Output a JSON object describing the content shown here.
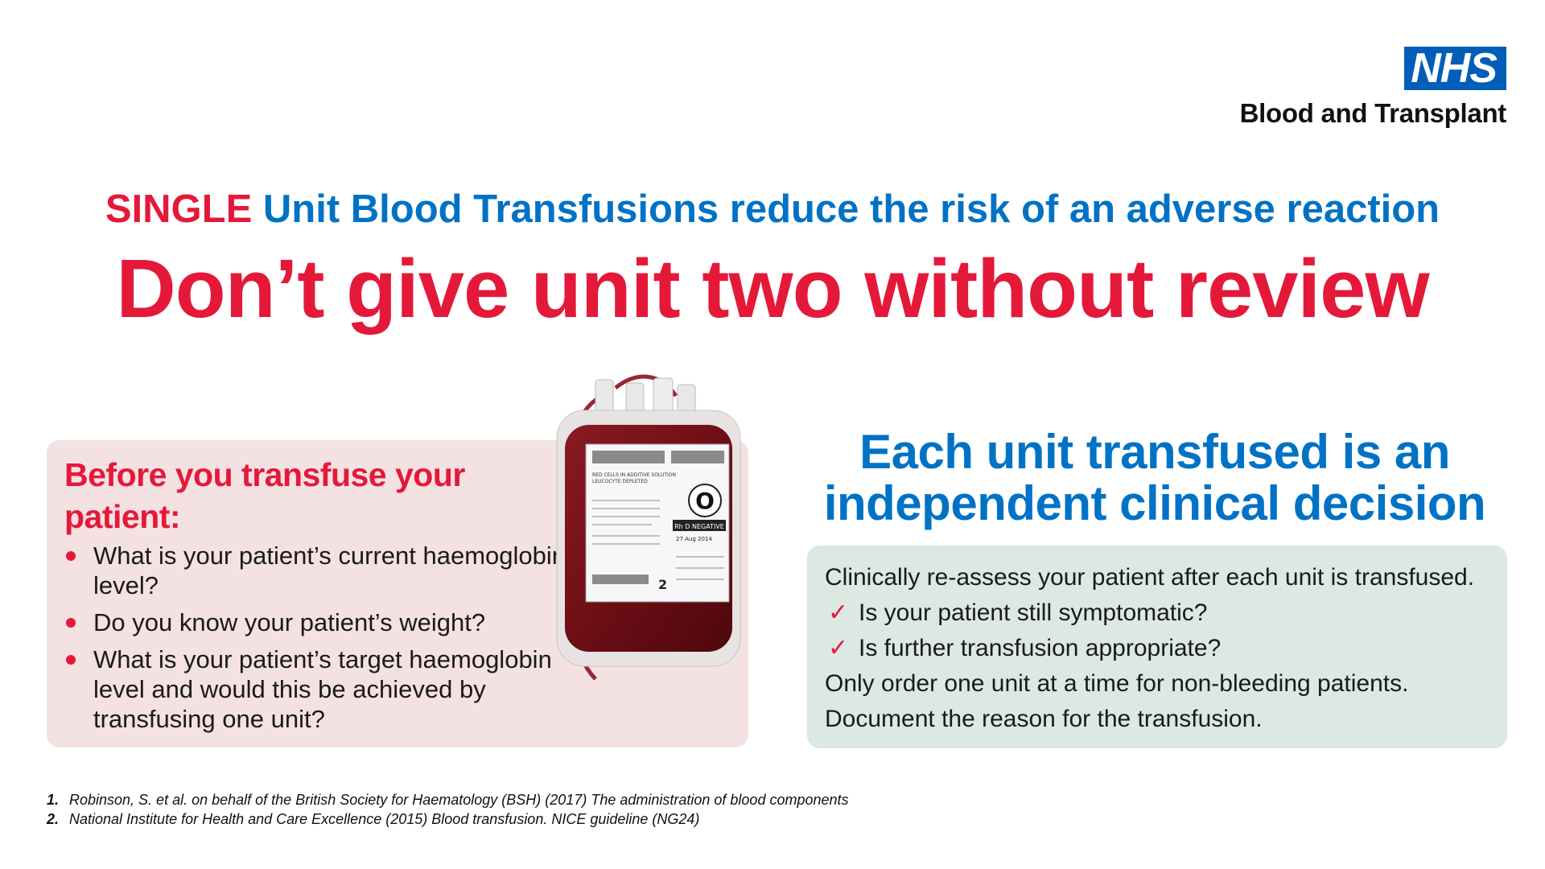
{
  "logo": {
    "mark": "NHS",
    "org": "Blood and Transplant"
  },
  "headline": {
    "emphasis": "SINGLE",
    "rest": " Unit Blood Transfusions reduce the risk of an adverse reaction",
    "main": "Don’t give unit two without review"
  },
  "before": {
    "title": "Before you transfuse your patient:",
    "items": [
      "What is your patient’s current haemoglobin level?",
      "Do you know your patient’s weight?",
      "What is your patient’s target haemoglobin level and would this be achieved by transfusing one unit?"
    ]
  },
  "bag": {
    "label_product": "RED CELLS IN ADDITIVE SOLUTION",
    "label_leuco": "LEUCOCYTE DEPLETED",
    "group": "O",
    "rh": "Rh D NEGATIVE",
    "expiry": "27 Aug 2014",
    "unit_num": "2"
  },
  "each": {
    "title": "Each unit transfused is an independent clinical decision",
    "intro": "Clinically re-assess your patient after each unit is transfused.",
    "checks": [
      "Is your patient still symptomatic?",
      "Is further transfusion appropriate?"
    ],
    "notes": [
      "Only order one unit at a time for non-bleeding patients.",
      "Document the reason for the transfusion."
    ]
  },
  "references": [
    {
      "num": "1.",
      "text": "Robinson, S. et al. on behalf of the British Society for Haematology (BSH) (2017) The administration of blood components"
    },
    {
      "num": "2.",
      "text": "National Institute for Health and Care Excellence (2015) Blood transfusion. NICE guideline (NG24)"
    }
  ],
  "colors": {
    "nhs_blue": "#005EB8",
    "heading_blue": "#0072C6",
    "red": "#E4193A",
    "pink_panel": "#F4E1E1",
    "green_panel": "#DCE8E2"
  }
}
